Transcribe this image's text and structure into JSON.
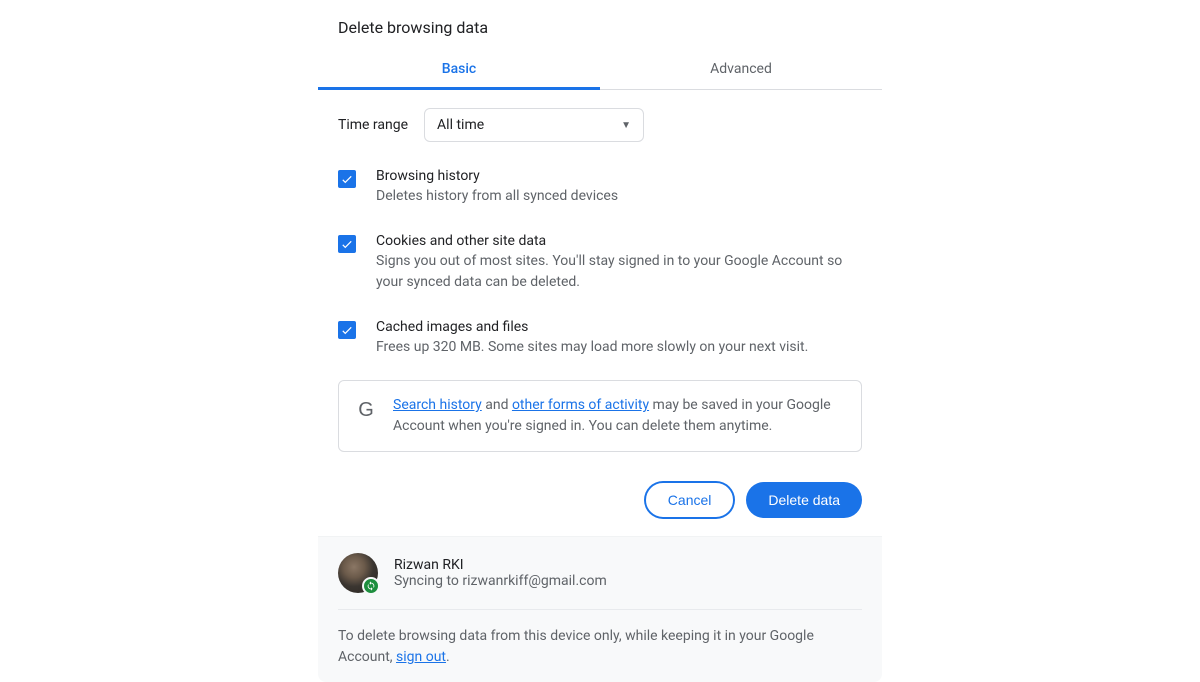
{
  "dialog": {
    "title": "Delete browsing data",
    "tabs": {
      "basic": "Basic",
      "advanced": "Advanced"
    },
    "timerange": {
      "label": "Time range",
      "value": "All time"
    },
    "options": {
      "history": {
        "title": "Browsing history",
        "desc": "Deletes history from all synced devices"
      },
      "cookies": {
        "title": "Cookies and other site data",
        "desc": "Signs you out of most sites. You'll stay signed in to your Google Account so your synced data can be deleted."
      },
      "cache": {
        "title": "Cached images and files",
        "desc": "Frees up 320 MB. Some sites may load more slowly on your next visit."
      }
    },
    "info": {
      "link1": "Search history",
      "text1": " and ",
      "link2": "other forms of activity",
      "text2": " may be saved in your Google Account when you're signed in. You can delete them anytime."
    },
    "actions": {
      "cancel": "Cancel",
      "delete": "Delete data"
    }
  },
  "profile": {
    "name": "Rizwan RKI",
    "sync_prefix": "Syncing to ",
    "email": "rizwanrkiff@gmail.com"
  },
  "footer": {
    "text1": "To delete browsing data from this device only, while keeping it in your Google Account, ",
    "link": "sign out",
    "text2": "."
  },
  "icons": {
    "g": "G"
  }
}
